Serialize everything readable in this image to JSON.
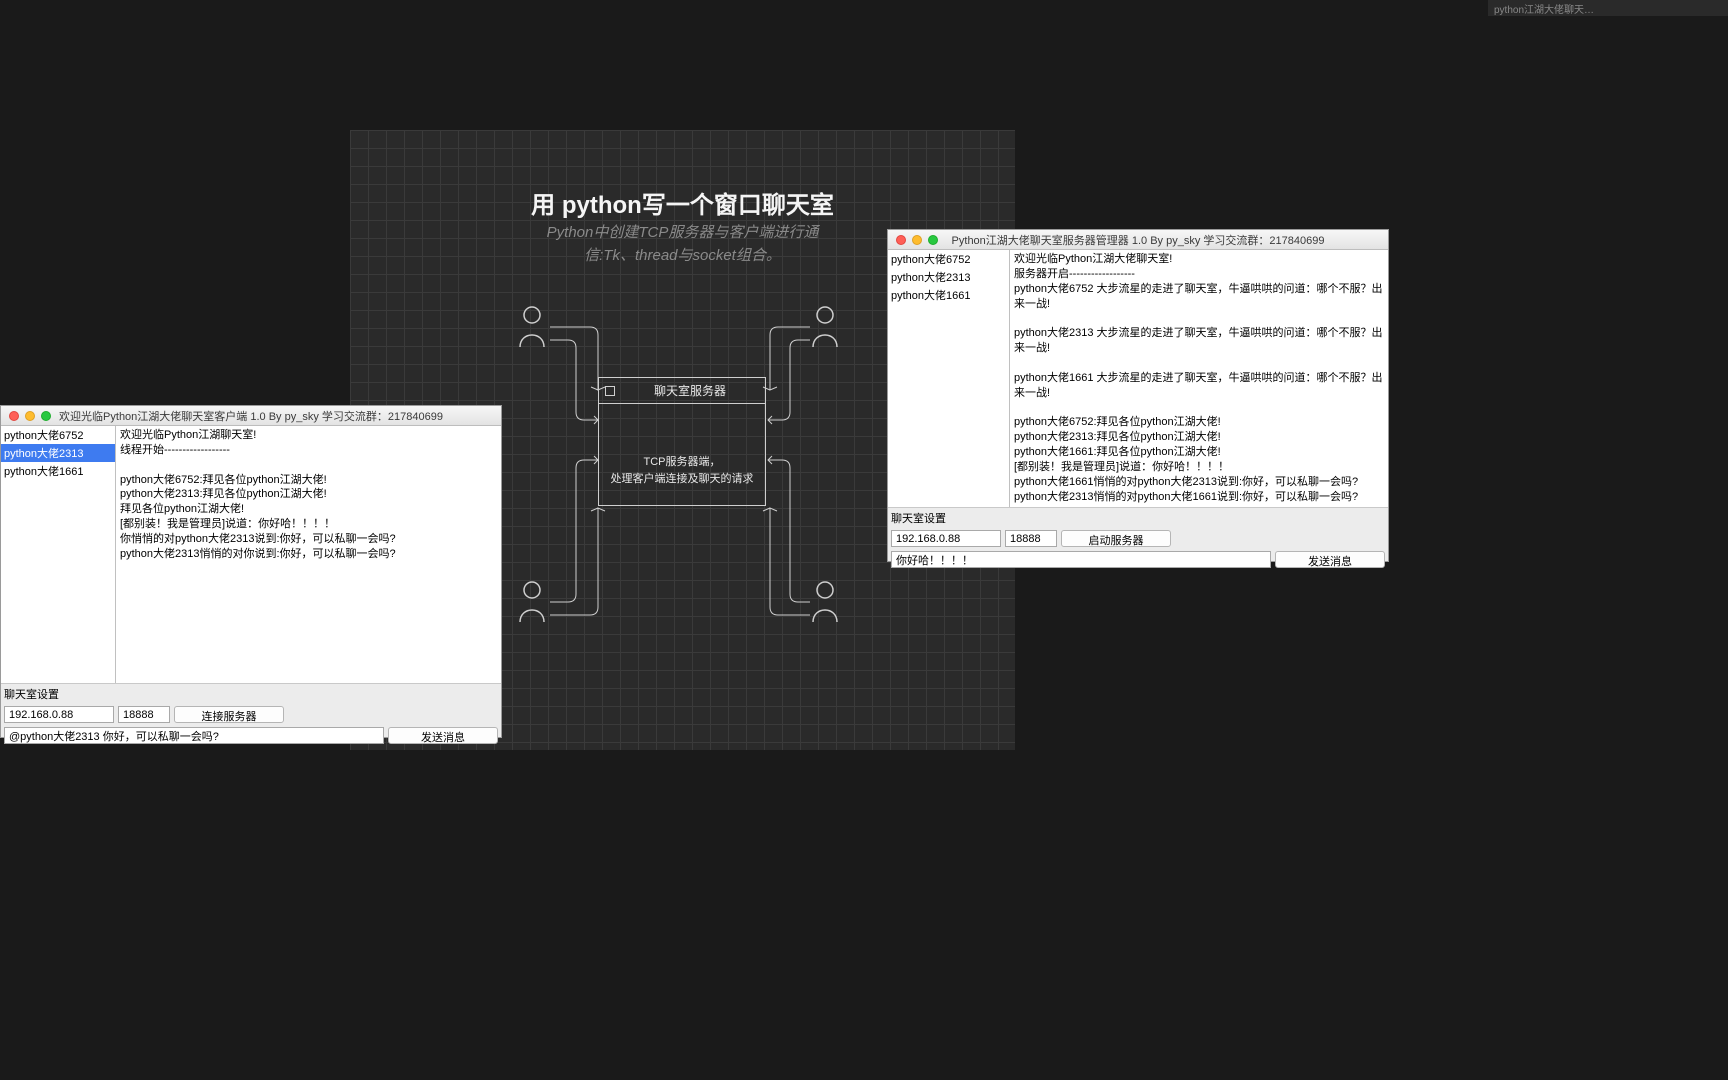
{
  "toptab_hint": "python江湖大佬聊天…",
  "canvas": {
    "title": "用 python写一个窗口聊天室",
    "subtitle_line1": "Python中创建TCP服务器与客户端进行通",
    "subtitle_line2": "信:Tk、thread与socket组合。",
    "server_box_title": "聊天室服务器",
    "server_box_body_line1": "TCP服务器端，",
    "server_box_body_line2": "处理客户端连接及聊天的请求"
  },
  "client": {
    "title": "欢迎光临Python江湖大佬聊天室客户端 1.0 By py_sky 学习交流群：217840699",
    "users": [
      "python大佬6752",
      "python大佬2313",
      "python大佬1661"
    ],
    "selected_index": 1,
    "chat_text": "欢迎光临Python江湖聊天室!\n线程开始------------------\n\npython大佬6752:拜见各位python江湖大佬!\npython大佬2313:拜见各位python江湖大佬!\n拜见各位python江湖大佬!\n[都别装！我是管理员]说道：你好哈！！！！\n你悄悄的对python大佬2313说到:你好，可以私聊一会吗?\npython大佬2313悄悄的对你说到:你好，可以私聊一会吗?",
    "settings_label": "聊天室设置",
    "ip": "192.168.0.88",
    "port": "18888",
    "connect_btn": "连接服务器",
    "msg": "@python大佬2313 你好，可以私聊一会吗?",
    "send_btn": "发送消息"
  },
  "server": {
    "title": "Python江湖大佬聊天室服务器管理器 1.0 By py_sky 学习交流群：217840699",
    "users": [
      "python大佬6752",
      "python大佬2313",
      "python大佬1661"
    ],
    "chat_text": "欢迎光临Python江湖大佬聊天室!\n服务器开启------------------\npython大佬6752 大步流星的走进了聊天室，牛逼哄哄的问道：哪个不服？出来一战!\n\npython大佬2313 大步流星的走进了聊天室，牛逼哄哄的问道：哪个不服？出来一战!\n\npython大佬1661 大步流星的走进了聊天室，牛逼哄哄的问道：哪个不服？出来一战!\n\npython大佬6752:拜见各位python江湖大佬!\npython大佬2313:拜见各位python江湖大佬!\npython大佬1661:拜见各位python江湖大佬!\n[都别装！我是管理员]说道：你好哈！！！！\npython大佬1661悄悄的对python大佬2313说到:你好，可以私聊一会吗?\npython大佬2313悄悄的对python大佬1661说到:你好，可以私聊一会吗?",
    "settings_label": "聊天室设置",
    "ip": "192.168.0.88",
    "port": "18888",
    "start_btn": "启动服务器",
    "msg": "你好哈！！！！",
    "send_btn": "发送消息"
  }
}
